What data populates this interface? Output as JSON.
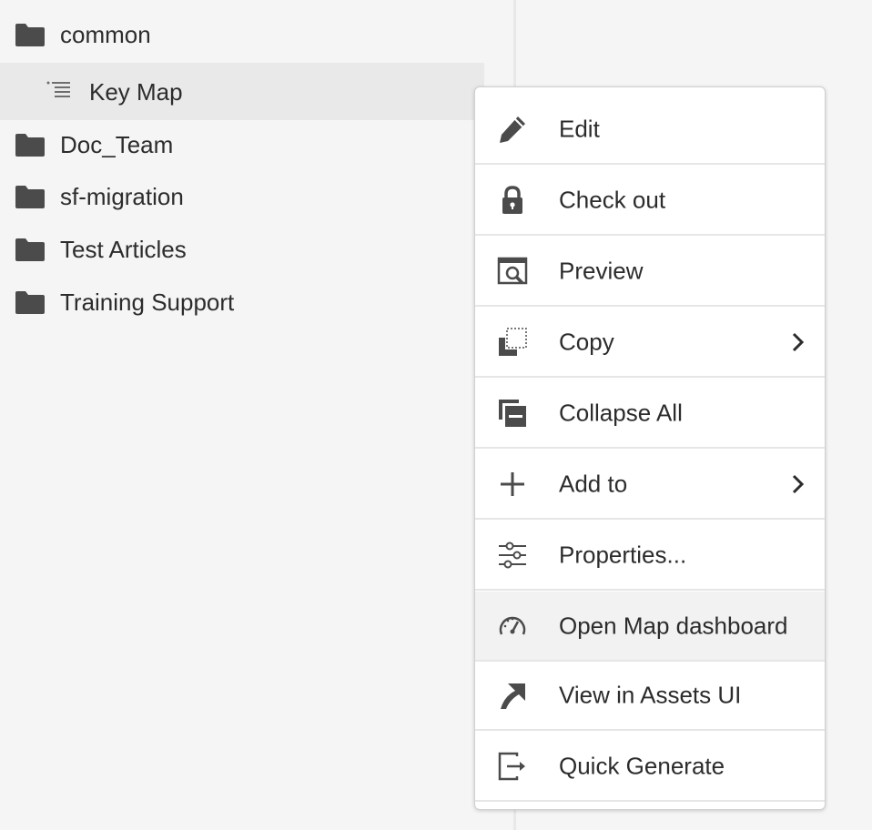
{
  "tree": {
    "items": [
      {
        "label": "common",
        "icon": "folder-icon"
      },
      {
        "label": "Key Map",
        "icon": "map-list-icon"
      },
      {
        "label": "Doc_Team",
        "icon": "folder-icon"
      },
      {
        "label": "sf-migration",
        "icon": "folder-icon"
      },
      {
        "label": "Test Articles",
        "icon": "folder-icon"
      },
      {
        "label": "Training Support",
        "icon": "folder-icon"
      }
    ]
  },
  "context_menu": {
    "items": [
      {
        "label": "Edit",
        "icon": "pencil-icon"
      },
      {
        "label": "Check out",
        "icon": "lock-icon"
      },
      {
        "label": "Preview",
        "icon": "preview-icon"
      },
      {
        "label": "Copy",
        "icon": "copy-icon",
        "submenu": true
      },
      {
        "label": "Collapse All",
        "icon": "collapse-all-icon"
      },
      {
        "label": "Add to",
        "icon": "plus-icon",
        "submenu": true
      },
      {
        "label": "Properties...",
        "icon": "properties-icon"
      },
      {
        "label": "Open Map dashboard",
        "icon": "dashboard-icon"
      },
      {
        "label": "View in Assets UI",
        "icon": "external-arrow-icon"
      },
      {
        "label": "Quick Generate",
        "icon": "export-icon"
      }
    ]
  },
  "colors": {
    "icon": "#4b4b4b",
    "text": "#2c2c2c",
    "selected_bg": "#e9e9e9",
    "highlight_bg": "#f2f2f2",
    "menu_bg": "#ffffff"
  }
}
